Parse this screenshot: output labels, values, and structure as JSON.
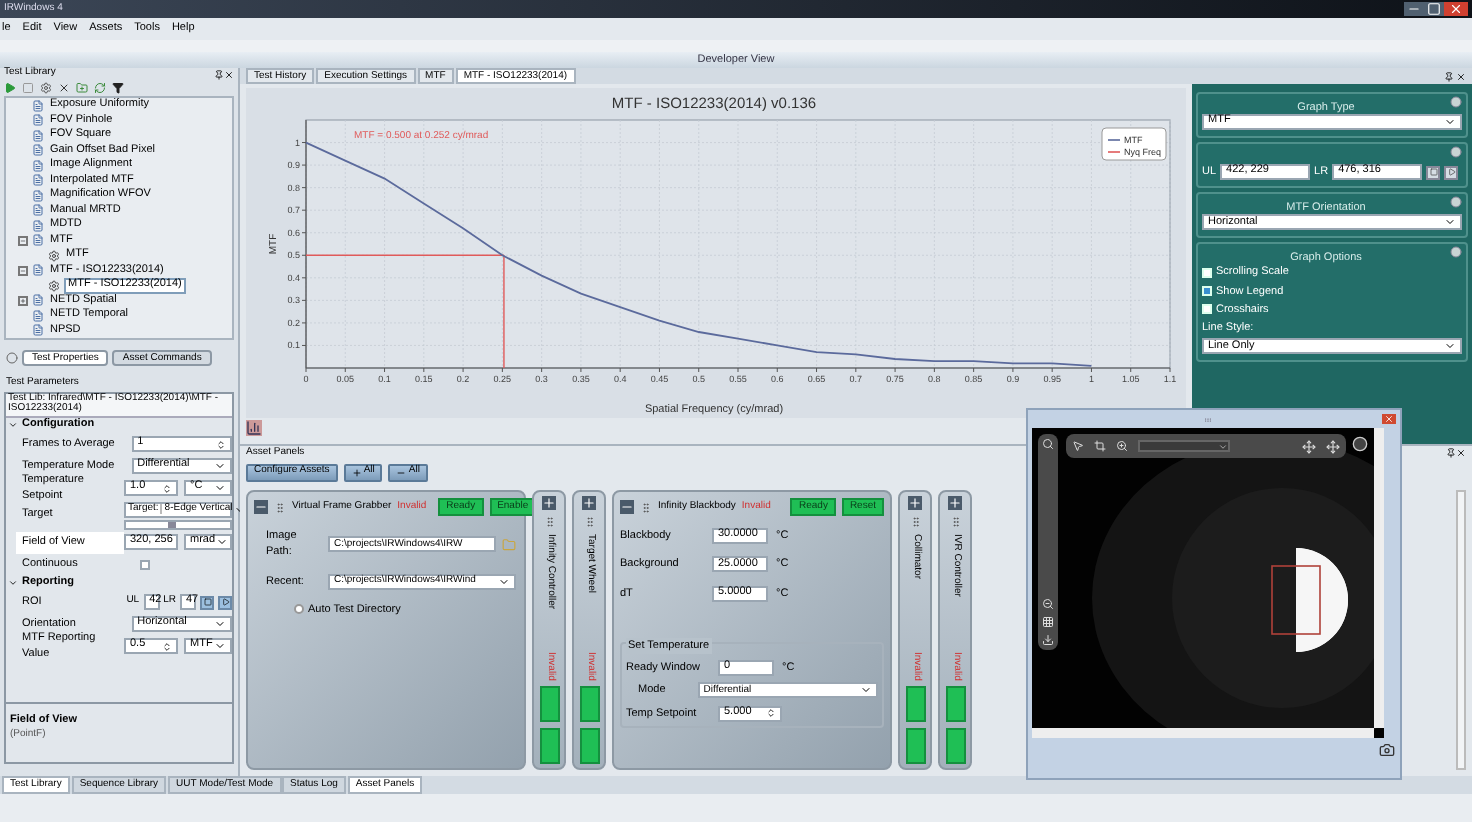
{
  "window": {
    "title": "IRWindows 4"
  },
  "menu": [
    "le",
    "Edit",
    "View",
    "Assets",
    "Tools",
    "Help"
  ],
  "view_title": "Developer View",
  "test_library": {
    "title": "Test Library",
    "tree": [
      {
        "label": "Exposure Uniformity",
        "selected": false
      },
      {
        "label": "FOV Pinhole",
        "selected": false
      },
      {
        "label": "FOV Square",
        "selected": false
      },
      {
        "label": "Gain Offset Bad Pixel",
        "selected": false
      },
      {
        "label": "Image Alignment",
        "selected": false
      },
      {
        "label": "Interpolated MTF",
        "selected": false
      },
      {
        "label": "Magnification WFOV",
        "selected": false
      },
      {
        "label": "Manual MRTD",
        "selected": false
      },
      {
        "label": "MDTD",
        "selected": false
      },
      {
        "label": "MTF",
        "selected": false,
        "expanded": true,
        "children": [
          {
            "label": "MTF",
            "selected": false
          }
        ]
      },
      {
        "label": "MTF - ISO12233(2014)",
        "selected": false,
        "expanded": true,
        "children": [
          {
            "label": "MTF - ISO12233(2014)",
            "selected": true
          }
        ]
      },
      {
        "label": "NETD Spatial",
        "selected": false,
        "expanded": false
      },
      {
        "label": "NETD Temporal",
        "selected": false
      },
      {
        "label": "NPSD",
        "selected": false
      }
    ]
  },
  "left_tabs": [
    {
      "label": "Test Properties",
      "selected": true
    },
    {
      "label": "Asset Commands",
      "selected": false
    }
  ],
  "test_parameters": {
    "title": "Test Parameters",
    "path": "Test Lib: Infrared\\MTF - ISO12233(2014)\\MTF - ISO12233(2014)",
    "sections": [
      {
        "title": "Configuration",
        "expanded": true,
        "rows": [
          {
            "label": "Frames to Average",
            "kind": "spin",
            "value": "1",
            "selected": false
          },
          {
            "label": "Temperature Mode",
            "kind": "dropdown",
            "value": "Differential",
            "selected": false
          },
          {
            "label": "Temperature Setpoint",
            "kind": "spin_unit",
            "value": "1.0",
            "unit": "°C",
            "selected": false
          },
          {
            "label": "Target",
            "kind": "target",
            "prefix": "Target:",
            "value": "8-Edge Vertical",
            "level": 0.45,
            "selected": false
          },
          {
            "label": "Field of View",
            "kind": "text_unit",
            "value": "320, 256",
            "unit": "mrad",
            "selected": true
          },
          {
            "label": "Continuous",
            "kind": "checkbox",
            "checked": false,
            "selected": false
          }
        ]
      },
      {
        "title": "Reporting",
        "expanded": true,
        "rows": [
          {
            "label": "ROI",
            "kind": "roi",
            "fields": [
              {
                "label": "UL",
                "value": "42"
              },
              {
                "label": "LR",
                "value": "47"
              }
            ],
            "selected": false
          },
          {
            "label": "Orientation",
            "kind": "dropdown",
            "value": "Horizontal",
            "selected": false
          },
          {
            "label": "MTF Reporting Value",
            "kind": "spin_unit",
            "value": "0.5",
            "unit": "MTF",
            "selected": false
          }
        ]
      }
    ]
  },
  "description": {
    "title": "Field of View",
    "text": "(PointF)"
  },
  "left_bottom_tabs": [
    {
      "label": "Test Library",
      "selected": true
    },
    {
      "label": "Sequence Library",
      "selected": false
    },
    {
      "label": "UUT Mode/Test Mode",
      "selected": false
    }
  ],
  "doc_tabs": [
    {
      "label": "Test History",
      "selected": false
    },
    {
      "label": "Execution Settings",
      "selected": false
    },
    {
      "label": "MTF",
      "selected": false
    },
    {
      "label": "MTF - ISO12233(2014)",
      "selected": true
    }
  ],
  "chart": {
    "chart_data": {
      "type": "line",
      "title": "MTF - ISO12233(2014) v0.136",
      "xlabel": "Spatial Frequency (cy/mrad)",
      "ylabel": "MTF",
      "x": [
        0,
        0.05,
        0.1,
        0.15,
        0.2,
        0.25,
        0.3,
        0.35,
        0.4,
        0.45,
        0.5,
        0.55,
        0.6,
        0.65,
        0.7,
        0.75,
        0.8,
        0.85,
        0.9,
        0.95,
        1
      ],
      "series": [
        {
          "name": "MTF",
          "color": "#5b6a9c",
          "values": [
            1.0,
            0.92,
            0.84,
            0.73,
            0.62,
            0.5,
            0.41,
            0.33,
            0.27,
            0.21,
            0.16,
            0.13,
            0.1,
            0.07,
            0.06,
            0.04,
            0.03,
            0.03,
            0.02,
            0.02,
            0.01
          ]
        },
        {
          "name": "Nyq Freq",
          "color": "#e05a5a",
          "values": [
            null,
            null,
            null,
            null,
            null,
            null,
            null,
            null,
            null,
            null,
            null,
            null,
            null,
            null,
            null,
            null,
            null,
            null,
            null,
            null,
            null
          ]
        }
      ],
      "xlim": [
        0,
        1.1
      ],
      "ylim": [
        0,
        1.1
      ],
      "xticks": [
        0,
        0.05,
        0.1,
        0.15,
        0.2,
        0.25,
        0.3,
        0.35,
        0.4,
        0.45,
        0.5,
        0.55,
        0.6,
        0.65,
        0.7,
        0.75,
        0.8,
        0.85,
        0.9,
        0.95,
        1,
        1.05,
        1.1
      ],
      "yticks": [
        0.1,
        0.2,
        0.3,
        0.4,
        0.5,
        0.6,
        0.7,
        0.8,
        0.9,
        1
      ],
      "grid": true,
      "ref_lines": [
        {
          "axis": "x",
          "value": 0.252
        },
        {
          "axis": "y",
          "value": 0.5
        }
      ],
      "annotations": [
        "MTF = 0.500 at 0.252 cy/mrad"
      ]
    }
  },
  "graph_panel": {
    "sections": [
      {
        "kind": "dropdown",
        "title": "Graph Type",
        "value": "MTF"
      },
      {
        "kind": "roi",
        "fields": [
          {
            "label": "UL",
            "value": "422, 229"
          },
          {
            "label": "LR",
            "value": "476, 316"
          }
        ]
      },
      {
        "kind": "dropdown",
        "title": "MTF Orientation",
        "value": "Horizontal"
      },
      {
        "kind": "options",
        "title": "Graph Options",
        "options": [
          {
            "label": "Scrolling Scale",
            "checked": false
          },
          {
            "label": "Show Legend",
            "checked": true
          },
          {
            "label": "Crosshairs",
            "checked": false
          }
        ],
        "line_style_label": "Line Style:",
        "line_style": "Line Only"
      }
    ]
  },
  "asset_panels": {
    "title": "Asset Panels",
    "buttons": [
      {
        "kind": "text",
        "label": "Configure Assets"
      },
      {
        "kind": "expand",
        "label": "All"
      },
      {
        "kind": "collapse",
        "label": "All"
      }
    ],
    "panels": [
      {
        "name": "Virtual Frame Grabber",
        "expanded": true,
        "status": "Invalid",
        "actions": [
          "Ready",
          "Enable"
        ],
        "fields": [
          {
            "kind": "path",
            "label": "Image Path:",
            "value": "C:\\projects\\IRWindows4\\IRW"
          },
          {
            "kind": "dropdown",
            "label": "Recent:",
            "value": "C:\\projects\\IRWindows4\\IRWind"
          },
          {
            "kind": "radio",
            "label": "Auto Test Directory",
            "selected": false
          }
        ]
      },
      {
        "name": "Infinity Controller",
        "expanded": false,
        "status": "Invalid"
      },
      {
        "name": "Target Wheel",
        "expanded": false,
        "status": "Invalid"
      },
      {
        "name": "Infinity Blackbody",
        "expanded": true,
        "status": "Invalid",
        "actions": [
          "Ready",
          "Reset"
        ],
        "fields": [
          {
            "kind": "number",
            "label": "Blackbody",
            "value": "30.0000",
            "unit": "°C"
          },
          {
            "kind": "number",
            "label": "Background",
            "value": "25.0000",
            "unit": "°C"
          },
          {
            "kind": "number",
            "label": "dT",
            "value": "5.0000",
            "unit": "°C"
          },
          {
            "kind": "group",
            "label": "Set Temperature",
            "fields": [
              {
                "kind": "number",
                "label": "Ready Window",
                "value": "0",
                "unit": "°C"
              },
              {
                "kind": "dropdown",
                "label": "Mode",
                "value": "Differential"
              },
              {
                "kind": "spin",
                "label": "Temp Setpoint",
                "value": "5.000"
              }
            ]
          }
        ]
      },
      {
        "name": "Collimator",
        "expanded": false,
        "status": "Invalid"
      },
      {
        "name": "IVR Controller",
        "expanded": false,
        "status": "Invalid"
      }
    ]
  },
  "center_bottom_tabs": [
    {
      "label": "Status Log",
      "selected": false
    },
    {
      "label": "Asset Panels",
      "selected": true
    }
  ]
}
